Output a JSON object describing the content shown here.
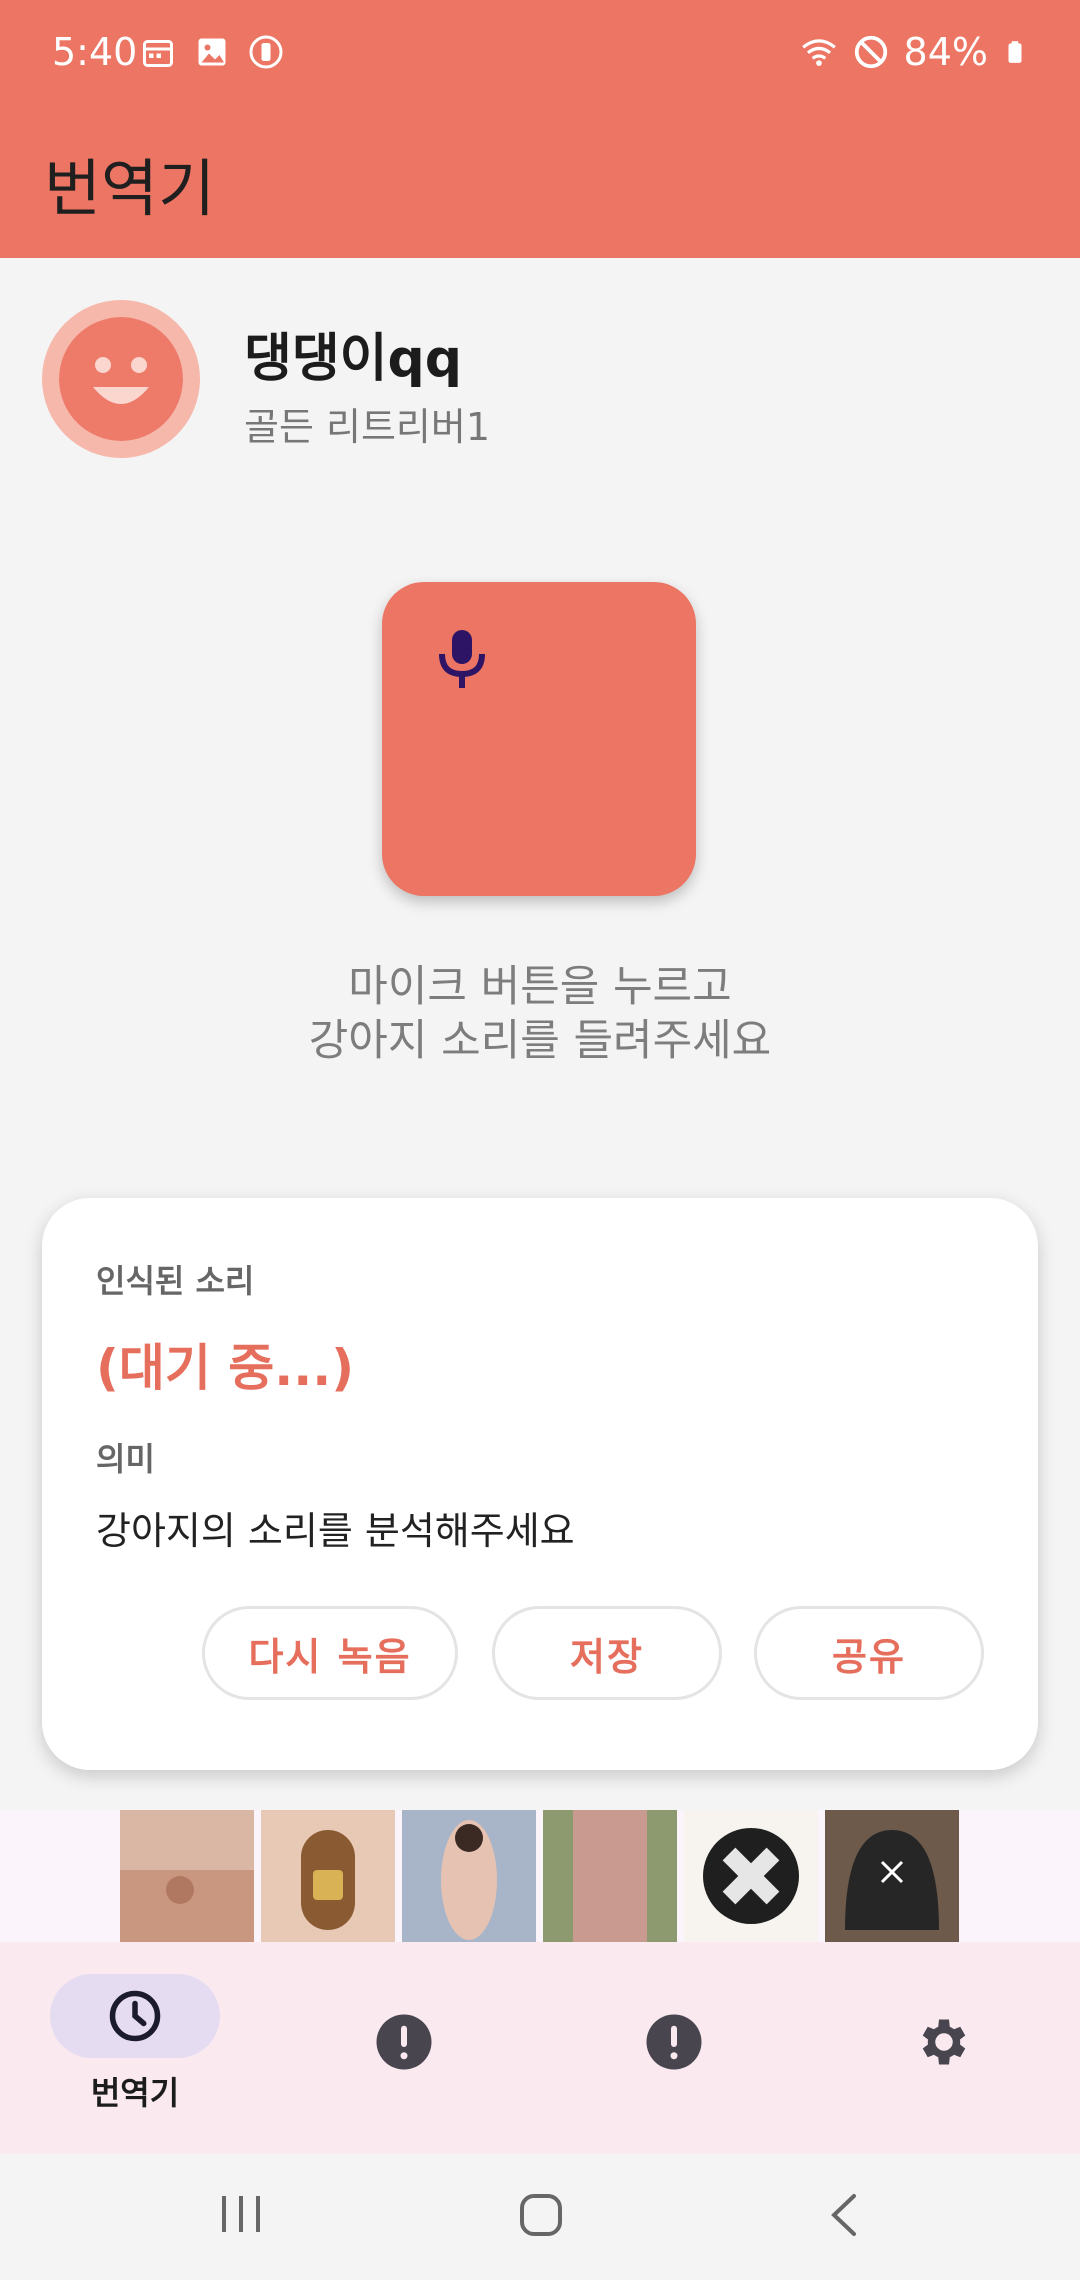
{
  "status_bar": {
    "time": "5:40",
    "battery": "84%",
    "icons_left": [
      "calendar-icon",
      "image-icon",
      "vibrate-icon"
    ],
    "icons_right": [
      "wifi-icon",
      "do-not-disturb-icon",
      "battery-icon"
    ]
  },
  "app_bar": {
    "title": "번역기"
  },
  "profile": {
    "name": "댕댕이qq",
    "breed": "골든 리트리버1"
  },
  "recorder": {
    "mic_icon": "microphone-icon",
    "instruction_line1": "마이크 버튼을 누르고",
    "instruction_line2": "강아지 소리를 들려주세요"
  },
  "result_card": {
    "recognized_label": "인식된 소리",
    "recognized_value": "(대기 중...)",
    "meaning_label": "의미",
    "meaning_value": "강아지의 소리를 분석해주세요",
    "actions": {
      "rerecord": "다시 녹음",
      "save": "저장",
      "share": "공유"
    }
  },
  "bottom_nav": {
    "items": [
      {
        "label": "번역기",
        "icon": "history-icon",
        "active": true
      },
      {
        "label": "",
        "icon": "alert-icon",
        "active": false
      },
      {
        "label": "",
        "icon": "alert-icon",
        "active": false
      },
      {
        "label": "",
        "icon": "gear-icon",
        "active": false
      }
    ]
  },
  "colors": {
    "accent": "#ec7563",
    "accent_text": "#e66e5c",
    "nav_bg": "#fae9ef",
    "nav_active": "#e6dcf2"
  }
}
